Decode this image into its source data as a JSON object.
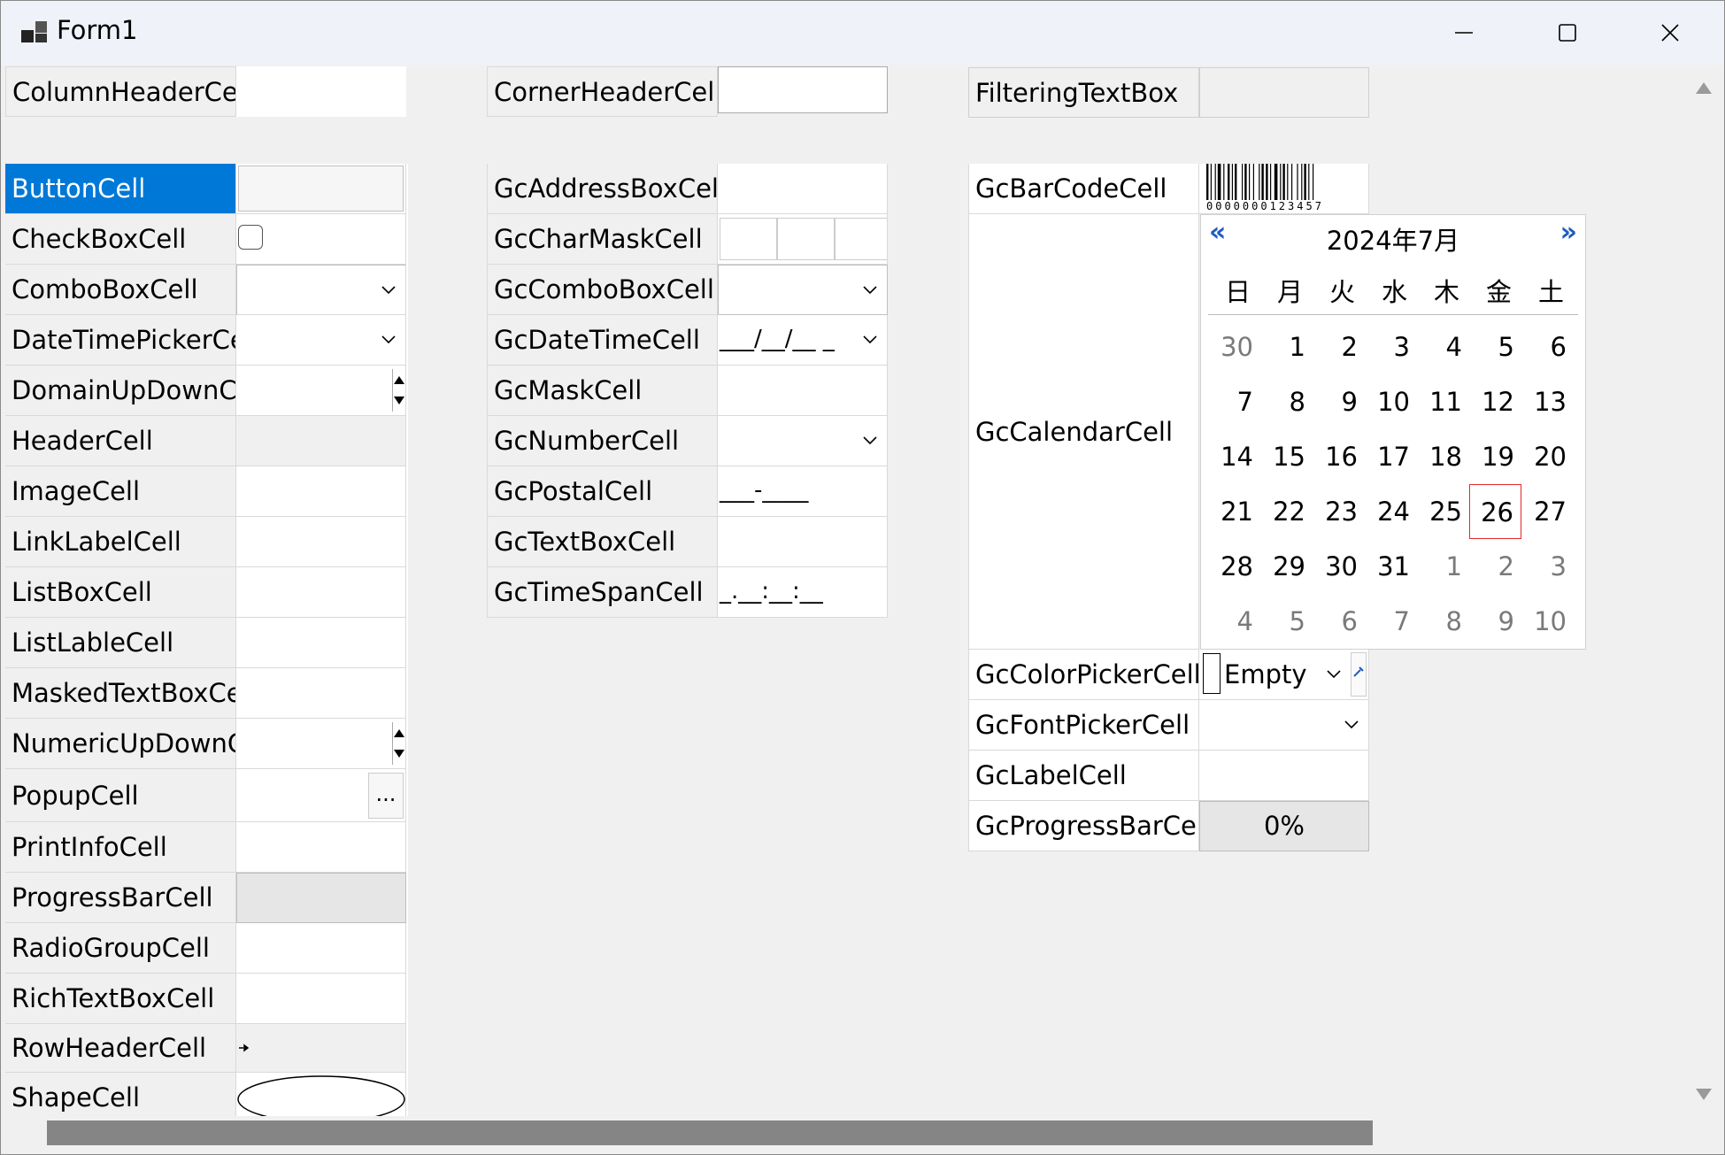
{
  "window": {
    "title": "Form1"
  },
  "top_row": [
    {
      "label": "ColumnHeaderCell"
    },
    {
      "label": "CornerHeaderCell"
    },
    {
      "label": "FilteringTextBox"
    }
  ],
  "col1": [
    {
      "label": "ButtonCell",
      "selected": true
    },
    {
      "label": "CheckBoxCell"
    },
    {
      "label": "ComboBoxCell"
    },
    {
      "label": "DateTimePickerCell"
    },
    {
      "label": "DomainUpDownCe"
    },
    {
      "label": "HeaderCell"
    },
    {
      "label": "ImageCell"
    },
    {
      "label": "LinkLabelCell"
    },
    {
      "label": "ListBoxCell"
    },
    {
      "label": "ListLableCell"
    },
    {
      "label": "MaskedTextBoxCell"
    },
    {
      "label": "NumericUpDownCe"
    },
    {
      "label": "PopupCell",
      "button": "..."
    },
    {
      "label": "PrintInfoCell"
    },
    {
      "label": "ProgressBarCell"
    },
    {
      "label": "RadioGroupCell"
    },
    {
      "label": "RichTextBoxCell"
    },
    {
      "label": "RowHeaderCell"
    },
    {
      "label": "ShapeCell"
    }
  ],
  "col2": [
    {
      "label": "GcAddressBoxCell"
    },
    {
      "label": "GcCharMaskCell"
    },
    {
      "label": "GcComboBoxCell"
    },
    {
      "label": "GcDateTimeCell",
      "value": "___/__/__ _"
    },
    {
      "label": "GcMaskCell"
    },
    {
      "label": "GcNumberCell"
    },
    {
      "label": "GcPostalCell",
      "value": "___-____"
    },
    {
      "label": "GcTextBoxCell"
    },
    {
      "label": "GcTimeSpanCell",
      "value": "_.__:__:__"
    }
  ],
  "col3": {
    "barcode": {
      "label": "GcBarCodeCell",
      "digits": "0000000123457"
    },
    "calendar": {
      "label": "GcCalendarCell",
      "title": "2024年7月",
      "prev": "«",
      "next": "»",
      "weekdays": [
        "日",
        "月",
        "火",
        "水",
        "木",
        "金",
        "土"
      ],
      "weeks": [
        [
          "30",
          "1",
          "2",
          "3",
          "4",
          "5",
          "6"
        ],
        [
          "7",
          "8",
          "9",
          "10",
          "11",
          "12",
          "13"
        ],
        [
          "14",
          "15",
          "16",
          "17",
          "18",
          "19",
          "20"
        ],
        [
          "21",
          "22",
          "23",
          "24",
          "25",
          "26",
          "27"
        ],
        [
          "28",
          "29",
          "30",
          "31",
          "1",
          "2",
          "3"
        ],
        [
          "4",
          "5",
          "6",
          "7",
          "8",
          "9",
          "10"
        ]
      ],
      "today": "26"
    },
    "colorpicker": {
      "label": "GcColorPickerCell",
      "value": "Empty"
    },
    "fontpicker": {
      "label": "GcFontPickerCell"
    },
    "labelcell": {
      "label": "GcLabelCell"
    },
    "progress": {
      "label": "GcProgressBarCell",
      "value": "0%"
    }
  },
  "colors": {
    "selection": "#0078d7",
    "today_border": "#e02b2b",
    "nav_arrow": "#1f5cbf"
  }
}
